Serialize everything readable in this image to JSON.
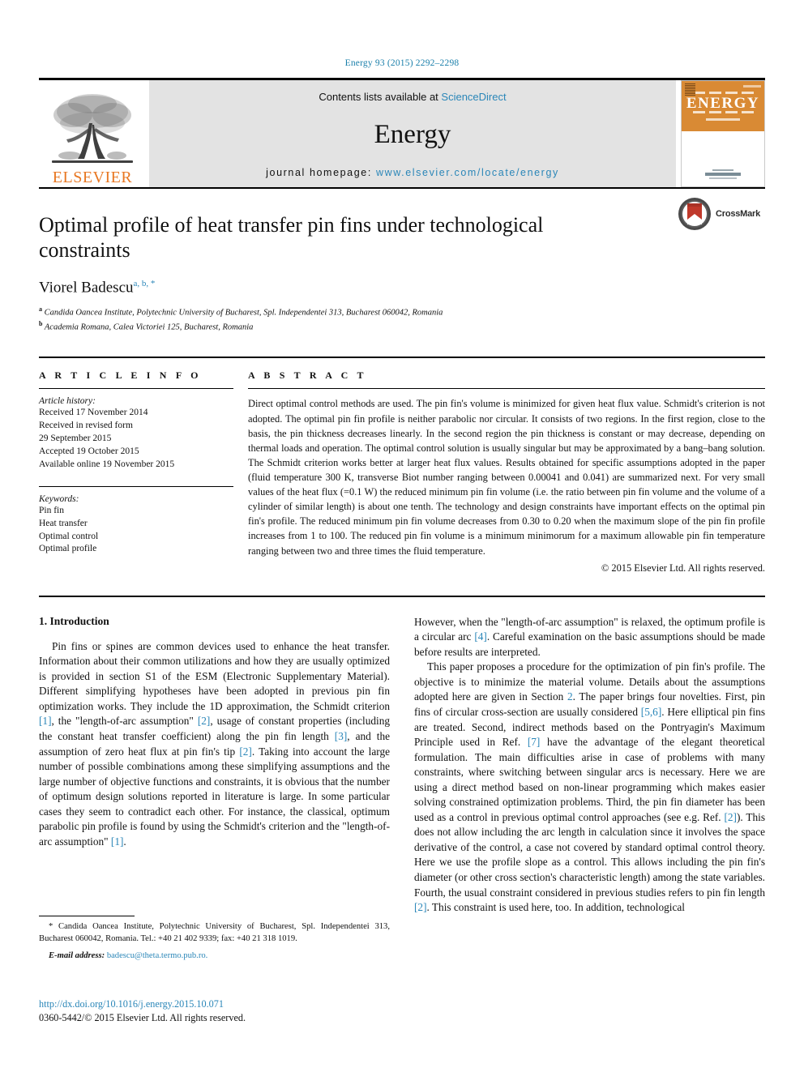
{
  "running_head": "Energy 93 (2015) 2292–2298",
  "masthead": {
    "publisher": "ELSEVIER",
    "contents_prefix": "Contents lists available at ",
    "contents_link": "ScienceDirect",
    "journal_title": "Energy",
    "homepage_prefix": "journal homepage: ",
    "homepage_url": "www.elsevier.com/locate/energy",
    "cover_title": "ENERGY"
  },
  "article": {
    "title": "Optimal profile of heat transfer pin fins under technological constraints",
    "crossmark_label": "CrossMark",
    "author_name": "Viorel Badescu",
    "author_marks": "a, b, *",
    "affiliations": [
      {
        "mark": "a",
        "text": "Candida Oancea Institute, Polytechnic University of Bucharest, Spl. Independentei 313, Bucharest 060042, Romania"
      },
      {
        "mark": "b",
        "text": "Academia Romana, Calea Victoriei 125, Bucharest, Romania"
      }
    ]
  },
  "info": {
    "heading": "A R T I C L E   I N F O",
    "history_label": "Article history:",
    "history": [
      "Received 17 November 2014",
      "Received in revised form",
      "29 September 2015",
      "Accepted 19 October 2015",
      "Available online 19 November 2015"
    ],
    "keywords_label": "Keywords:",
    "keywords": [
      "Pin fin",
      "Heat transfer",
      "Optimal control",
      "Optimal profile"
    ]
  },
  "abstract": {
    "heading": "A B S T R A C T",
    "text": "Direct optimal control methods are used. The pin fin's volume is minimized for given heat flux value. Schmidt's criterion is not adopted. The optimal pin fin profile is neither parabolic nor circular. It consists of two regions. In the first region, close to the basis, the pin thickness decreases linearly. In the second region the pin thickness is constant or may decrease, depending on thermal loads and operation. The optimal control solution is usually singular but may be approximated by a bang–bang solution. The Schmidt criterion works better at larger heat flux values. Results obtained for specific assumptions adopted in the paper (fluid temperature 300 K, transverse Biot number ranging between 0.00041 and 0.041) are summarized next. For very small values of the heat flux (=0.1 W) the reduced minimum pin fin volume (i.e. the ratio between pin fin volume and the volume of a cylinder of similar length) is about one tenth. The technology and design constraints have important effects on the optimal pin fin's profile. The reduced minimum pin fin volume decreases from 0.30 to 0.20 when the maximum slope of the pin fin profile increases from 1 to 100. The reduced pin fin volume is a minimum minimorum for a maximum allowable pin fin temperature ranging between two and three times the fluid temperature.",
    "copyright": "© 2015 Elsevier Ltd. All rights reserved."
  },
  "body": {
    "section_heading": "1. Introduction",
    "left_paragraph_1_a": "Pin fins or spines are common devices used to enhance the heat transfer. Information about their common utilizations and how they are usually optimized is provided in section S1 of the ESM (Electronic Supplementary Material). Different simplifying hypotheses have been adopted in previous pin fin optimization works. They include the 1D approximation, the Schmidt criterion ",
    "ref1": "[1]",
    "left_paragraph_1_b": ", the \"length-of-arc assumption\" ",
    "ref2": "[2]",
    "left_paragraph_1_c": ", usage of constant properties (including the constant heat transfer coefficient) along the pin fin length ",
    "ref3": "[3]",
    "left_paragraph_1_d": ", and the assumption of zero heat flux at pin fin's tip ",
    "ref4": "[2]",
    "left_paragraph_1_e": ". Taking into account the large number of possible combinations among these simplifying assumptions and the large number of objective functions and constraints, it is obvious that the number of optimum design solutions reported in literature is large. In some particular cases they seem to contradict each other. For instance, the classical, optimum parabolic pin profile is found by using the Schmidt's criterion and the \"length-of-arc assumption\" ",
    "ref5": "[1]",
    "left_paragraph_1_f": ".",
    "right_paragraph_1_a": "However, when the \"length-of-arc assumption\" is relaxed, the optimum profile is a circular arc ",
    "ref6": "[4]",
    "right_paragraph_1_b": ". Careful examination on the basic assumptions should be made before results are interpreted.",
    "right_paragraph_2_a": "This paper proposes a procedure for the optimization of pin fin's profile. The objective is to minimize the material volume. Details about the assumptions adopted here are given in Section ",
    "ref7": "2",
    "right_paragraph_2_b": ". The paper brings four novelties. First, pin fins of circular cross-section are usually considered ",
    "ref8": "[5,6]",
    "right_paragraph_2_c": ". Here elliptical pin fins are treated. Second, indirect methods based on the Pontryagin's Maximum Principle used in Ref. ",
    "ref9": "[7]",
    "right_paragraph_2_d": " have the advantage of the elegant theoretical formulation. The main difficulties arise in case of problems with many constraints, where switching between singular arcs is necessary. Here we are using a direct method based on non-linear programming which makes easier solving constrained optimization problems. Third, the pin fin diameter has been used as a control in previous optimal control approaches (see e.g. Ref. ",
    "ref10": "[2]",
    "right_paragraph_2_e": "). This does not allow including the arc length in calculation since it involves the space derivative of the control, a case not covered by standard optimal control theory. Here we use the profile slope as a control. This allows including the pin fin's diameter (or other cross section's characteristic length) among the state variables. Fourth, the usual constraint considered in previous studies refers to pin fin length ",
    "ref11": "[2]",
    "right_paragraph_2_f": ". This constraint is used here, too. In addition, technological"
  },
  "footnotes": {
    "corresponding": "* Candida Oancea Institute, Polytechnic University of Bucharest, Spl. Independentei 313, Bucharest 060042, Romania. Tel.: +40 21 402 9339; fax: +40 21 318 1019.",
    "email_label": "E-mail address:",
    "email": "badescu@theta.termo.pub.ro.",
    "doi": "http://dx.doi.org/10.1016/j.energy.2015.10.071",
    "issn": "0360-5442/© 2015 Elsevier Ltd. All rights reserved."
  },
  "colors": {
    "link": "#2a86b8",
    "elsevier_orange": "#E87722",
    "cover_orange": "#d98a34",
    "banner_gray": "#e3e3e3"
  }
}
